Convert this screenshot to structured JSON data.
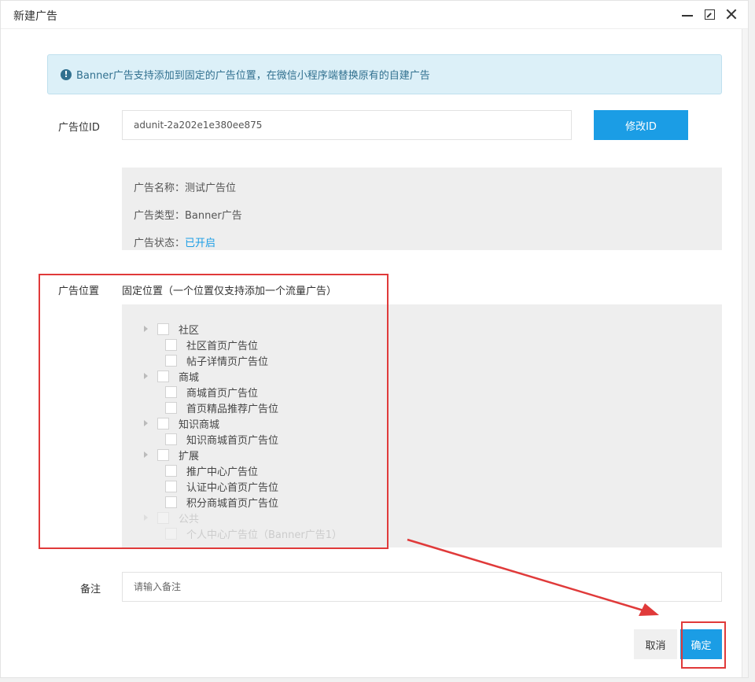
{
  "dialog": {
    "title": "新建广告",
    "controls": [
      "minimize-icon",
      "maximize-icon",
      "close-icon"
    ]
  },
  "alert": {
    "icon": "!",
    "text": "Banner广告支持添加到固定的广告位置，在微信小程序端替换原有的自建广告"
  },
  "ad_unit": {
    "label": "广告位ID",
    "value": "adunit-2a202e1e380ee875",
    "modify_button": "修改ID"
  },
  "ad_info": {
    "name_label": "广告名称：",
    "name_value": "测试广告位",
    "type_label": "广告类型：",
    "type_value": "Banner广告",
    "status_label": "广告状态：",
    "status_value": "已开启"
  },
  "position": {
    "label": "广告位置",
    "description": "固定位置（一个位置仅支持添加一个流量广告）",
    "tree": [
      {
        "label": "社区",
        "level": "parent",
        "disabled": false
      },
      {
        "label": "社区首页广告位",
        "level": "child",
        "disabled": false
      },
      {
        "label": "帖子详情页广告位",
        "level": "child",
        "disabled": false
      },
      {
        "label": "商城",
        "level": "parent",
        "disabled": false
      },
      {
        "label": "商城首页广告位",
        "level": "child",
        "disabled": false
      },
      {
        "label": "首页精品推荐广告位",
        "level": "child",
        "disabled": false
      },
      {
        "label": "知识商城",
        "level": "parent",
        "disabled": false
      },
      {
        "label": "知识商城首页广告位",
        "level": "child",
        "disabled": false
      },
      {
        "label": "扩展",
        "level": "parent",
        "disabled": false
      },
      {
        "label": "推广中心广告位",
        "level": "child",
        "disabled": false
      },
      {
        "label": "认证中心首页广告位",
        "level": "child",
        "disabled": false
      },
      {
        "label": "积分商城首页广告位",
        "level": "child",
        "disabled": false
      },
      {
        "label": "公共",
        "level": "parent",
        "disabled": true
      },
      {
        "label": "个人中心广告位（Banner广告1）",
        "level": "child",
        "disabled": true
      }
    ]
  },
  "remark": {
    "label": "备注",
    "placeholder": "请输入备注"
  },
  "footer": {
    "cancel": "取消",
    "confirm": "确定"
  },
  "colors": {
    "primary": "#1b9de5",
    "annotation": "#e03a3a",
    "alert_bg": "#dcf0f8"
  }
}
